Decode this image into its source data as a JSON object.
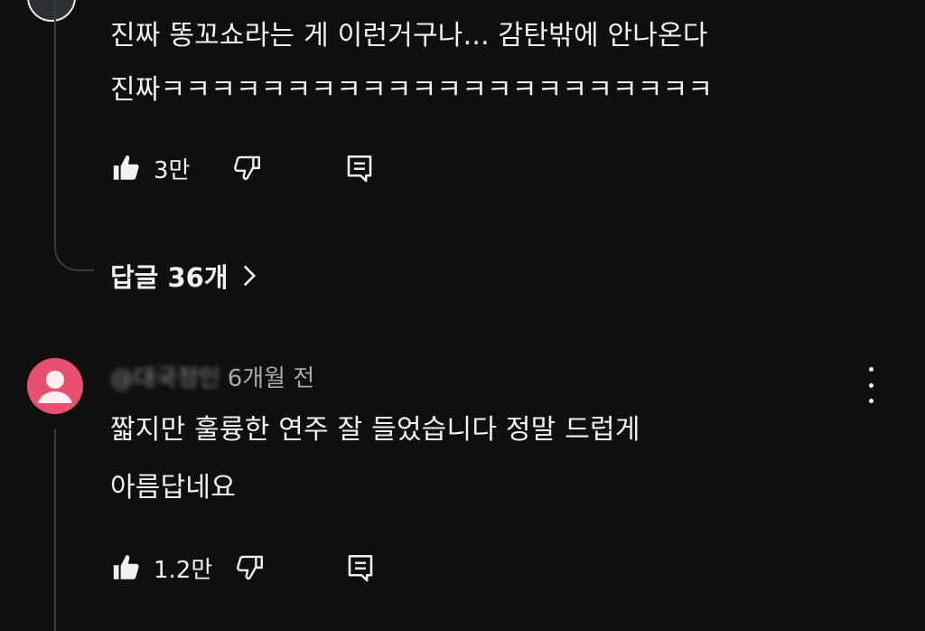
{
  "previous_comment": {
    "text_line1": "진짜 똥꼬쇼라는 게 이런거구나... 감탄밖에 안나온다",
    "text_line2": "진짜ㅋㅋㅋㅋㅋㅋㅋㅋㅋㅋㅋㅋㅋㅋㅋㅋㅋㅋㅋㅋㅋㅋ",
    "like_count": "3만",
    "replies_label": "답글 36개"
  },
  "comment": {
    "handle": "@대국정인",
    "time_ago": "6개월 전",
    "text_line1": "짧지만 훌륭한 연주 잘 들었습니다 정말 드럽게",
    "text_line2": "아름답네요",
    "like_count": "1.2만"
  },
  "icons": {
    "like": "thumbs-up-icon",
    "dislike": "thumbs-down-icon",
    "reply": "reply-comment-icon",
    "replies_chevron": "chevron-right-icon",
    "more": "more-vertical-icon",
    "avatar": "default-user-avatar-icon"
  },
  "colors": {
    "background": "#0f0f0f",
    "text": "#f1f1f1",
    "meta_text": "#aaaaaa",
    "avatar_bg": "#e8506f",
    "thread_line": "#3a3a3a"
  }
}
